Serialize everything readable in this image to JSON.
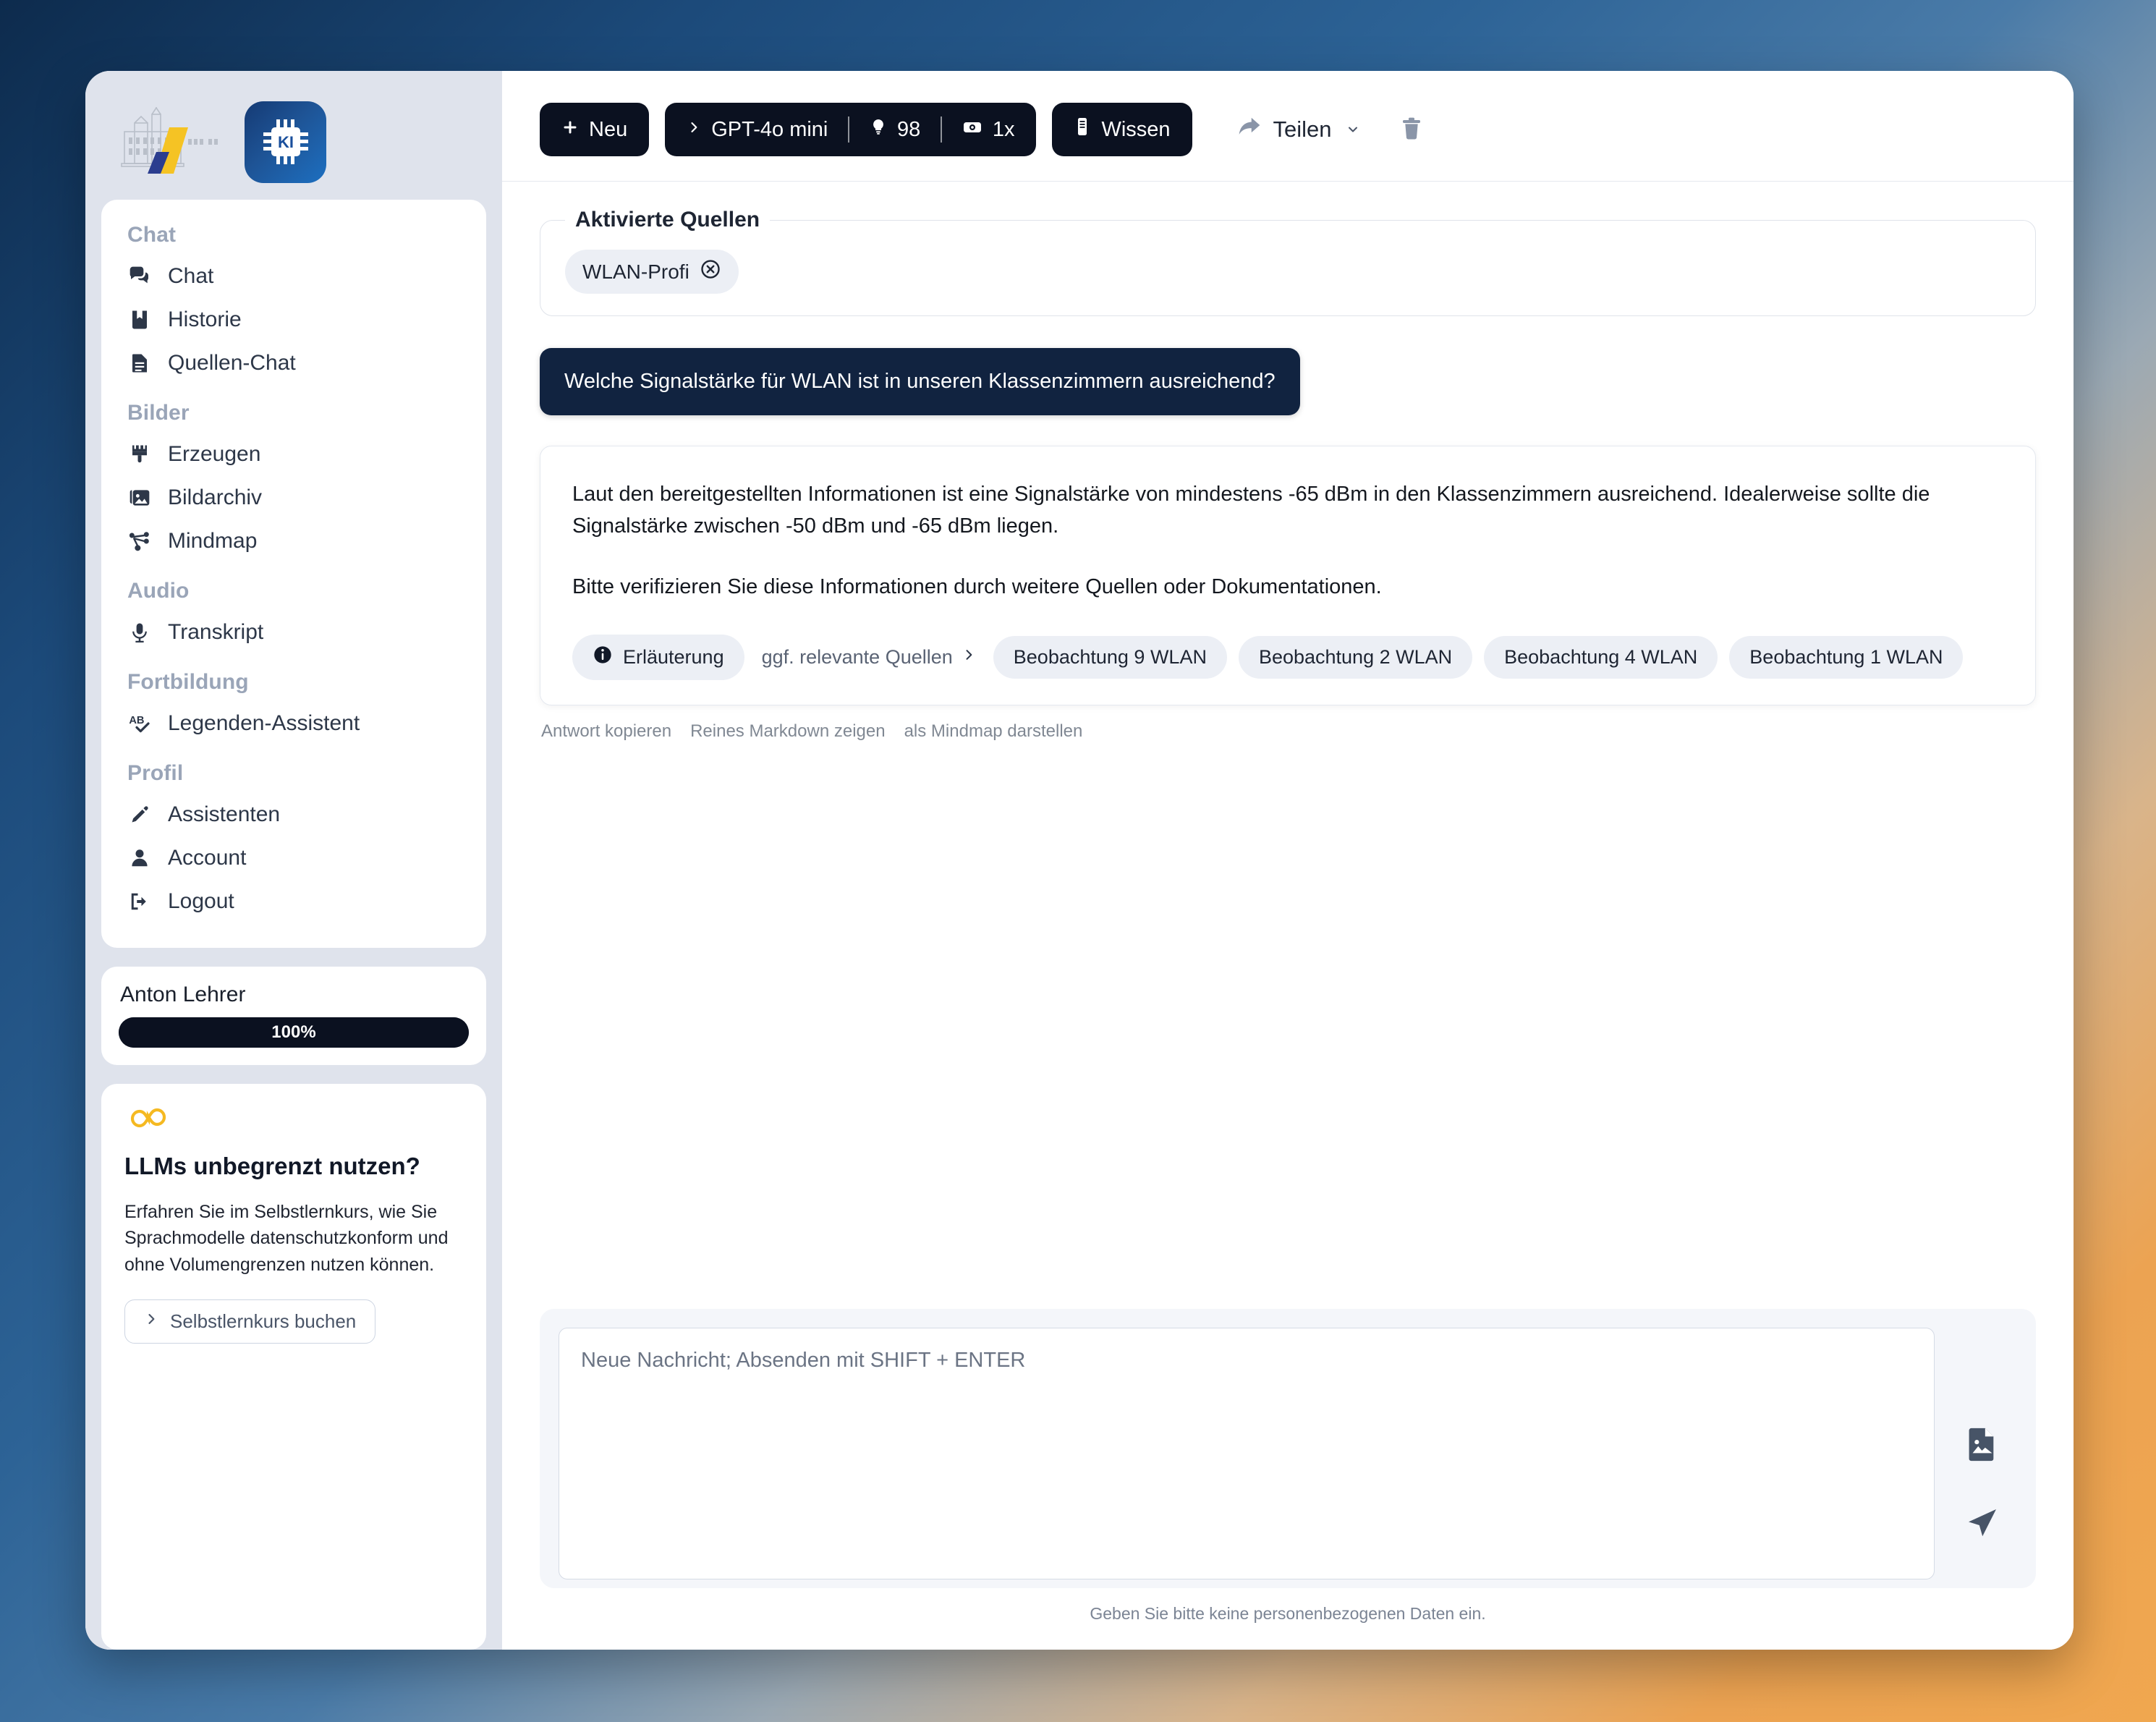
{
  "brand": {
    "ki_tile_label": "KI",
    "castle_logo_name": "schloss-logo"
  },
  "sidebar": {
    "groups": [
      {
        "title": "Chat",
        "items": [
          {
            "label": "Chat",
            "icon": "chat-bubbles-icon"
          },
          {
            "label": "Historie",
            "icon": "book-bookmark-icon"
          },
          {
            "label": "Quellen-Chat",
            "icon": "document-icon"
          }
        ]
      },
      {
        "title": "Bilder",
        "items": [
          {
            "label": "Erzeugen",
            "icon": "paintbrush-icon"
          },
          {
            "label": "Bildarchiv",
            "icon": "images-icon"
          },
          {
            "label": "Mindmap",
            "icon": "mindmap-icon"
          }
        ]
      },
      {
        "title": "Audio",
        "items": [
          {
            "label": "Transkript",
            "icon": "microphone-icon"
          }
        ]
      },
      {
        "title": "Fortbildung",
        "items": [
          {
            "label": "Legenden-Assistent",
            "icon": "spellcheck-icon"
          }
        ]
      },
      {
        "title": "Profil",
        "items": [
          {
            "label": "Assistenten",
            "icon": "pencil-icon"
          },
          {
            "label": "Account",
            "icon": "user-icon"
          },
          {
            "label": "Logout",
            "icon": "logout-icon"
          }
        ]
      }
    ],
    "user": {
      "name": "Anton Lehrer",
      "quota_percent": "100%",
      "quota_value": 100
    },
    "promo": {
      "icon": "infinity-icon",
      "title": "LLMs unbegrenzt nutzen?",
      "text": "Erfahren Sie im Selbstlernkurs, wie Sie Sprachmodelle datenschutzkonform und ohne Volumengrenzen nutzen können.",
      "button_label": "Selbstlernkurs buchen"
    }
  },
  "toolbar": {
    "new_label": "Neu",
    "model_label": "GPT-4o mini",
    "tokens_value": "98",
    "multiplier_value": "1x",
    "knowledge_label": "Wissen",
    "share_label": "Teilen",
    "delete_icon": "trash-icon"
  },
  "sources": {
    "legend": "Aktivierte Quellen",
    "chips": [
      {
        "label": "WLAN-Profi",
        "remove_icon": "circle-x-icon"
      }
    ]
  },
  "conversation": {
    "user_message": "Welche Signalstärke für WLAN ist in unseren Klassenzimmern ausreichend?",
    "assistant_paragraphs": [
      "Laut den bereitgestellten Informationen ist eine Signalstärke von mindestens -65 dBm in den Klassenzimmern ausreichend. Idealerweise sollte die Signalstärke zwischen -50 dBm und -65 dBm liegen.",
      "Bitte verifizieren Sie diese Informationen durch weitere Quellen oder Dokumentationen."
    ],
    "explanation_chip": "Erläuterung",
    "relevant_sources_label": "ggf. relevante Quellen",
    "source_chips": [
      "Beobachtung 9 WLAN",
      "Beobachtung 2 WLAN",
      "Beobachtung 4 WLAN",
      "Beobachtung 1 WLAN"
    ],
    "actions": [
      "Antwort kopieren",
      "Reines Markdown zeigen",
      "als Mindmap darstellen"
    ]
  },
  "composer": {
    "placeholder": "Neue Nachricht; Absenden mit SHIFT + ENTER",
    "value": "",
    "attach_icon": "file-image-icon",
    "send_icon": "send-icon",
    "note": "Geben Sie bitte keine personenbezogenen Daten ein."
  },
  "colors": {
    "accent_dark": "#0b1120",
    "user_bubble": "#112340",
    "sidebar_bg": "#dfe3ec",
    "brand_yellow": "#f5b921",
    "brand_blue": "#2b3d8f"
  }
}
